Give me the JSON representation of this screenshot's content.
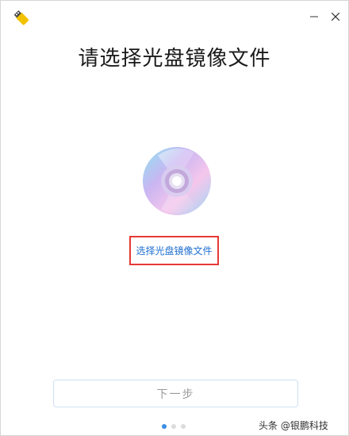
{
  "window": {
    "title": "请选择光盘镜像文件",
    "app_icon": "usb-drive-icon",
    "minimize_icon": "minimize-icon",
    "close_icon": "close-icon"
  },
  "main": {
    "disc_icon": "optical-disc-icon",
    "select_link_label": "选择光盘镜像文件"
  },
  "footer": {
    "next_label": "下一步",
    "step_indicator": {
      "total": 3,
      "current": 1
    }
  },
  "watermark": "头条 @银鹏科技",
  "colors": {
    "link": "#1f6fd1",
    "highlight_border": "#e53935",
    "button_border": "#cfe0f3",
    "active_dot": "#3a8ee6"
  }
}
